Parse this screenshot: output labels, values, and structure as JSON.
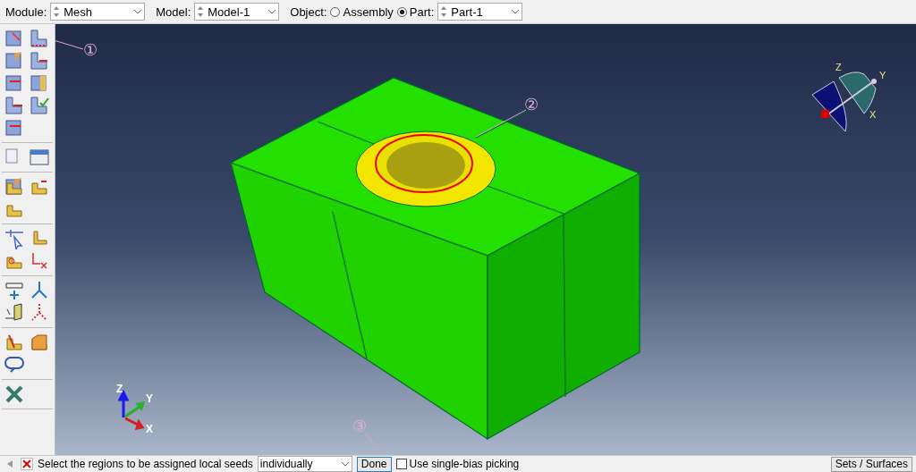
{
  "context_bar": {
    "module": {
      "label": "Module:",
      "value": "Mesh"
    },
    "model": {
      "label": "Model:",
      "value": "Model-1"
    },
    "object": {
      "label": "Object:",
      "options": [
        {
          "label": "Assembly",
          "selected": false
        },
        {
          "label": "Part:",
          "selected": true
        }
      ]
    },
    "part": {
      "value": "Part-1"
    }
  },
  "view_cube": {
    "z": "Z",
    "y": "Y",
    "x": "X"
  },
  "triad": {
    "z": "Z",
    "y": "Y",
    "x": "X"
  },
  "callouts": [
    {
      "number": "①"
    },
    {
      "number": "②"
    },
    {
      "number": "③"
    }
  ],
  "prompt": {
    "text": "Select the regions to be assigned local seeds",
    "mode": "individually",
    "done": "Done",
    "single_bias": {
      "label": "Use single-bias picking",
      "checked": false
    },
    "sets_button": "Sets / Surfaces"
  }
}
